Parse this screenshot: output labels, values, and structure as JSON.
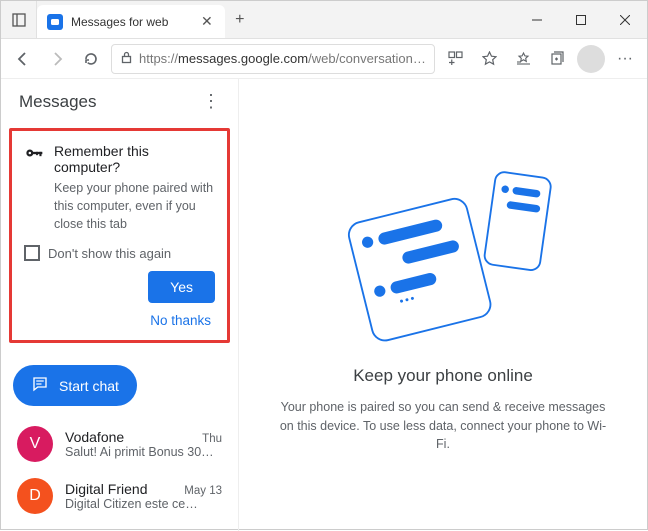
{
  "browser": {
    "tab_title": "Messages for web",
    "url_display": "https://messages.google.com/web/conversations?redirecte…",
    "url_host": "messages.google.com",
    "url_proto": "https://",
    "url_path": "/web/conversations?redirecte…"
  },
  "app": {
    "title": "Messages"
  },
  "prompt": {
    "title": "Remember this computer?",
    "body": "Keep your phone paired with this computer, even if you close this tab",
    "checkbox_label": "Don't show this again",
    "yes": "Yes",
    "no": "No thanks"
  },
  "start_chat": "Start chat",
  "conversations": [
    {
      "initial": "V",
      "color": "#d81b60",
      "name": "Vodafone",
      "time": "Thu",
      "preview": "Salut! Ai primit Bonus 30…"
    },
    {
      "initial": "D",
      "color": "#f4511e",
      "name": "Digital Friend",
      "time": "May 13",
      "preview": "Digital Citizen este ce…"
    }
  ],
  "empty_state": {
    "title": "Keep your phone online",
    "body": "Your phone is paired so you can send & receive messages on this device. To use less data, connect your phone to Wi-Fi."
  }
}
